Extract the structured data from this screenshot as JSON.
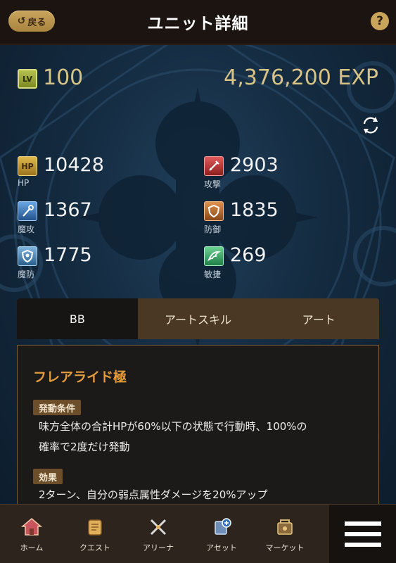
{
  "header": {
    "back_label": "戻る",
    "title": "ユニット詳細",
    "help_label": "?"
  },
  "level": {
    "badge": "LV",
    "value": "100",
    "exp": "4,376,200 EXP"
  },
  "stats": {
    "hp": {
      "icon_text": "HP",
      "label": "HP",
      "value": "10428",
      "icon": "hp-icon"
    },
    "atk": {
      "label": "攻撃",
      "value": "2903",
      "icon": "sword-icon"
    },
    "mag": {
      "label": "魔攻",
      "value": "1367",
      "icon": "staff-icon"
    },
    "def": {
      "label": "防御",
      "value": "1835",
      "icon": "shield-icon"
    },
    "mdef": {
      "label": "魔防",
      "value": "1775",
      "icon": "magic-shield-icon"
    },
    "agi": {
      "label": "敏捷",
      "value": "269",
      "icon": "wing-icon"
    }
  },
  "tabs": [
    {
      "label": "BB",
      "active": true
    },
    {
      "label": "アートスキル",
      "active": false
    },
    {
      "label": "アート",
      "active": false
    }
  ],
  "panel": {
    "skill_name": "フレアライド極",
    "condition_tag": "発動条件",
    "condition_line1": "味方全体の合計HPが60%以下の状態で行動時、100%の",
    "condition_line2": "確率で2度だけ発動",
    "effect_tag": "効果",
    "effect_line1": "2ターン、自分の弱点属性ダメージを20%アップ"
  },
  "nav": {
    "items": [
      {
        "label": "ホーム",
        "icon": "home-icon"
      },
      {
        "label": "クエスト",
        "icon": "scroll-icon"
      },
      {
        "label": "アリーナ",
        "icon": "crossed-swords-icon"
      },
      {
        "label": "アセット",
        "icon": "asset-icon"
      },
      {
        "label": "マーケット",
        "icon": "market-icon"
      }
    ],
    "menu": "hamburger-menu-icon"
  },
  "colors": {
    "accent_gold": "#d8c387",
    "skill_orange": "#e39b3e",
    "header_bg": "#1c1411"
  }
}
